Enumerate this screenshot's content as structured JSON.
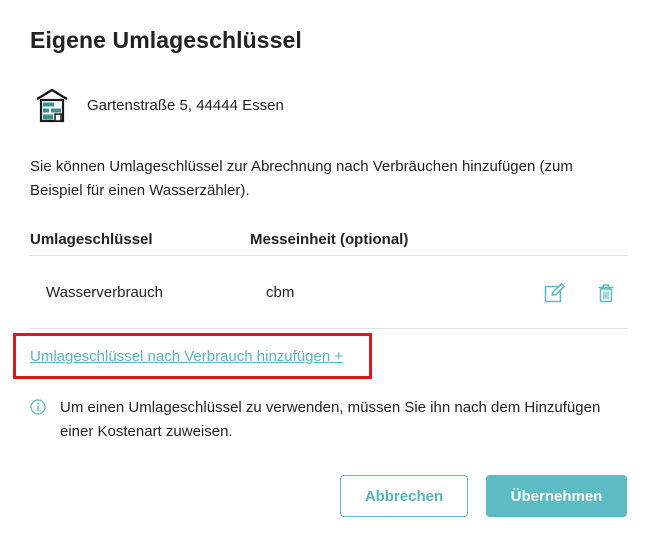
{
  "dialog": {
    "title": "Eigene Umlageschlüssel",
    "property": {
      "icon": "house-icon",
      "address": "Gartenstraße 5, 44444 Essen"
    },
    "description": "Sie können Umlageschlüssel zur Abrechnung nach Verbräuchen hinzufügen (zum Beispiel für einen Wasserzähler).",
    "table": {
      "headers": [
        "Umlageschlüssel",
        "Messeinheit (optional)"
      ],
      "rows": [
        {
          "key": "Wasserverbrauch",
          "unit": "cbm",
          "actions": [
            "edit-icon",
            "trash-icon"
          ]
        }
      ]
    },
    "add_link": "Umlageschlüssel nach Verbrauch hinzufügen +",
    "info": {
      "icon": "info-icon",
      "text": "Um einen Umlageschlüssel zu verwenden, müssen Sie ihn nach dem Hinzufügen einer Kostenart zuweisen."
    },
    "buttons": {
      "cancel": "Abbrechen",
      "confirm": "Übernehmen"
    },
    "colors": {
      "accent": "#5dbcc3",
      "highlight": "#e3141b",
      "text": "#222222"
    }
  }
}
